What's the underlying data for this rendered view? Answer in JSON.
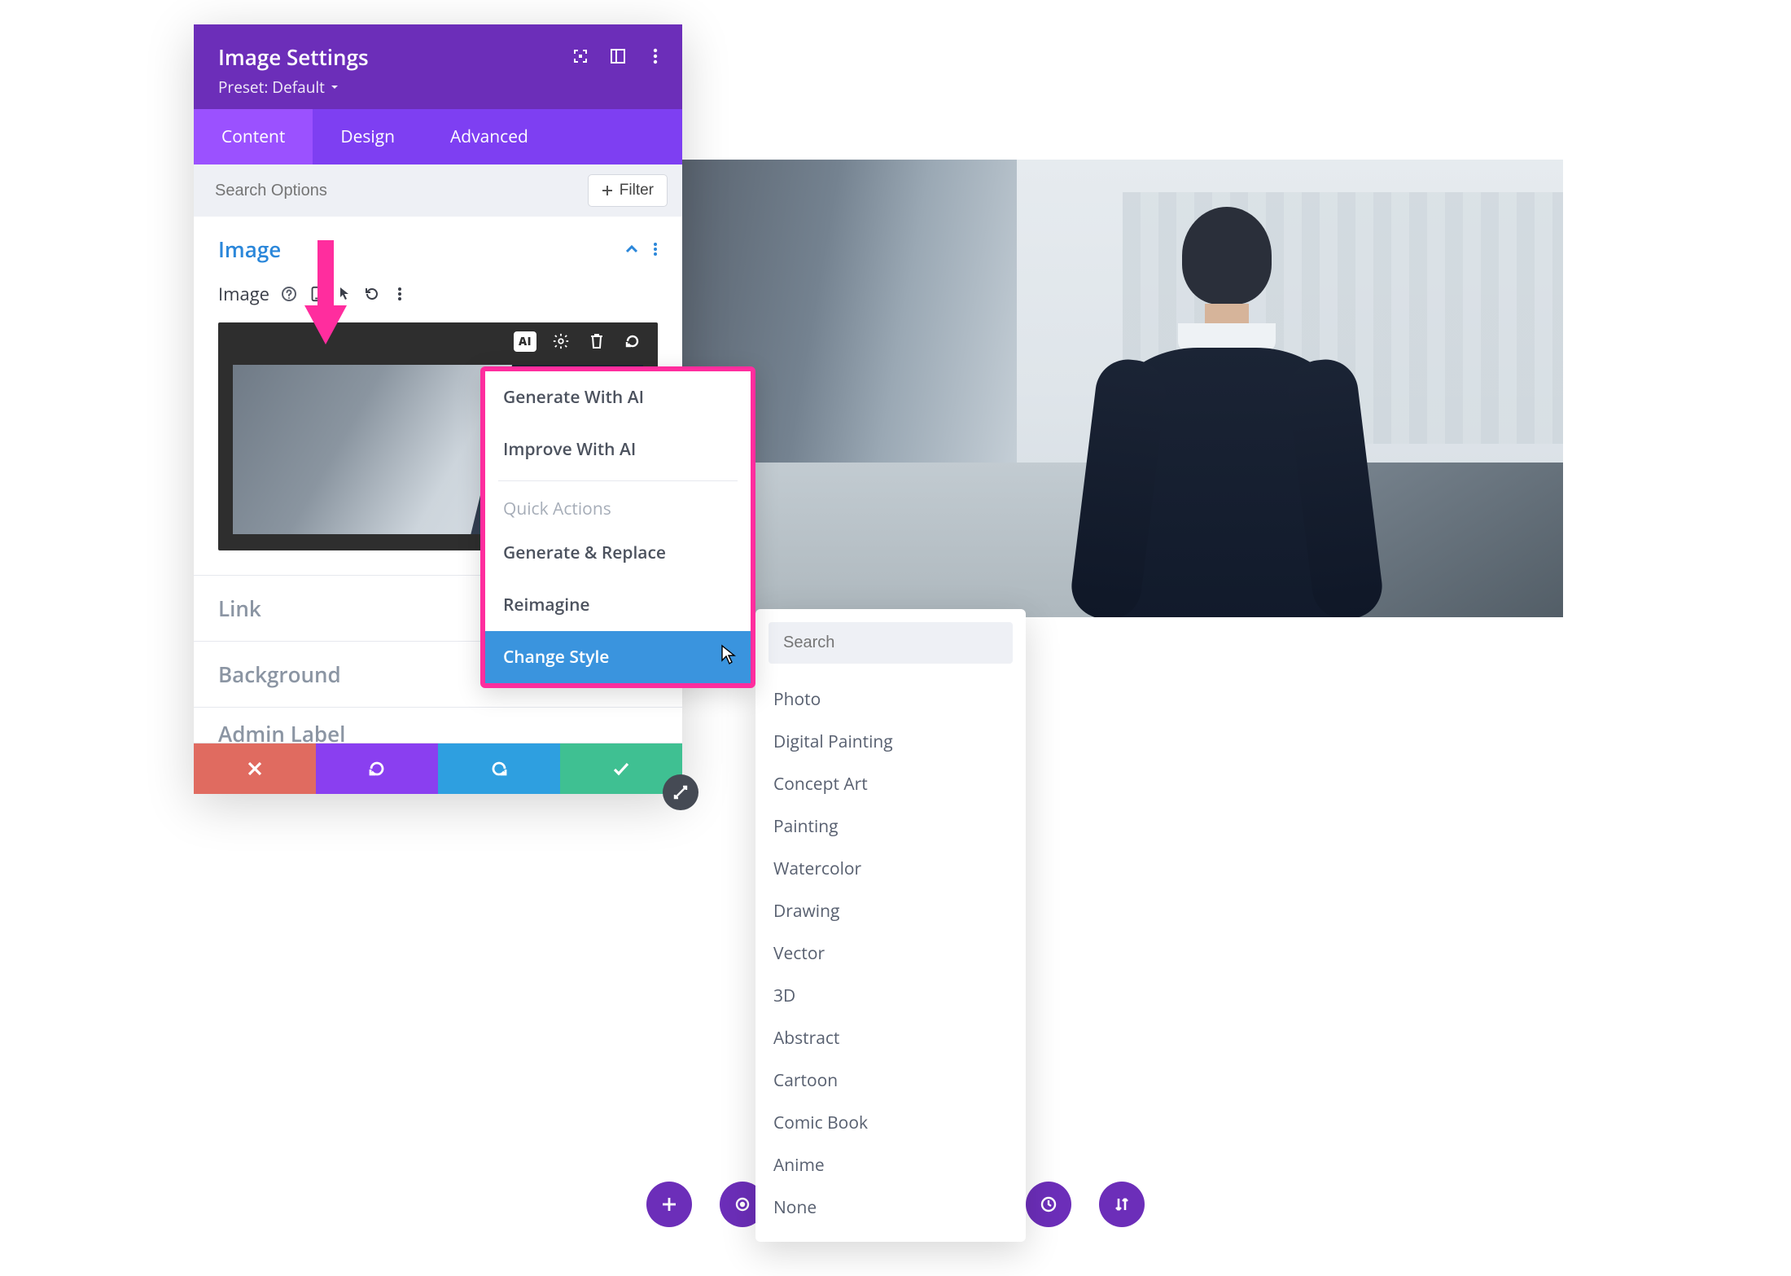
{
  "panel": {
    "title": "Image Settings",
    "preset_label": "Preset: Default",
    "tabs": [
      "Content",
      "Design",
      "Advanced"
    ],
    "active_tab": 0,
    "search_placeholder": "Search Options",
    "filter_label": "Filter",
    "sections": {
      "image": {
        "title": "Image",
        "field_label": "Image"
      },
      "link": {
        "title": "Link"
      },
      "background": {
        "title": "Background"
      },
      "admin_label": {
        "title": "Admin Label"
      }
    }
  },
  "ai_menu": {
    "items_top": [
      "Generate With AI",
      "Improve With AI"
    ],
    "quick_label": "Quick Actions",
    "items_quick": [
      "Generate & Replace",
      "Reimagine",
      "Change Style"
    ],
    "selected": "Change Style"
  },
  "style_menu": {
    "search_placeholder": "Search",
    "options": [
      "Photo",
      "Digital Painting",
      "Concept Art",
      "Painting",
      "Watercolor",
      "Drawing",
      "Vector",
      "3D",
      "Abstract",
      "Cartoon",
      "Comic Book",
      "Anime",
      "None"
    ]
  },
  "colors": {
    "brand_purple": "#6c2eb9",
    "highlight_pink": "#ff2d9e",
    "selected_blue": "#3a94de"
  }
}
